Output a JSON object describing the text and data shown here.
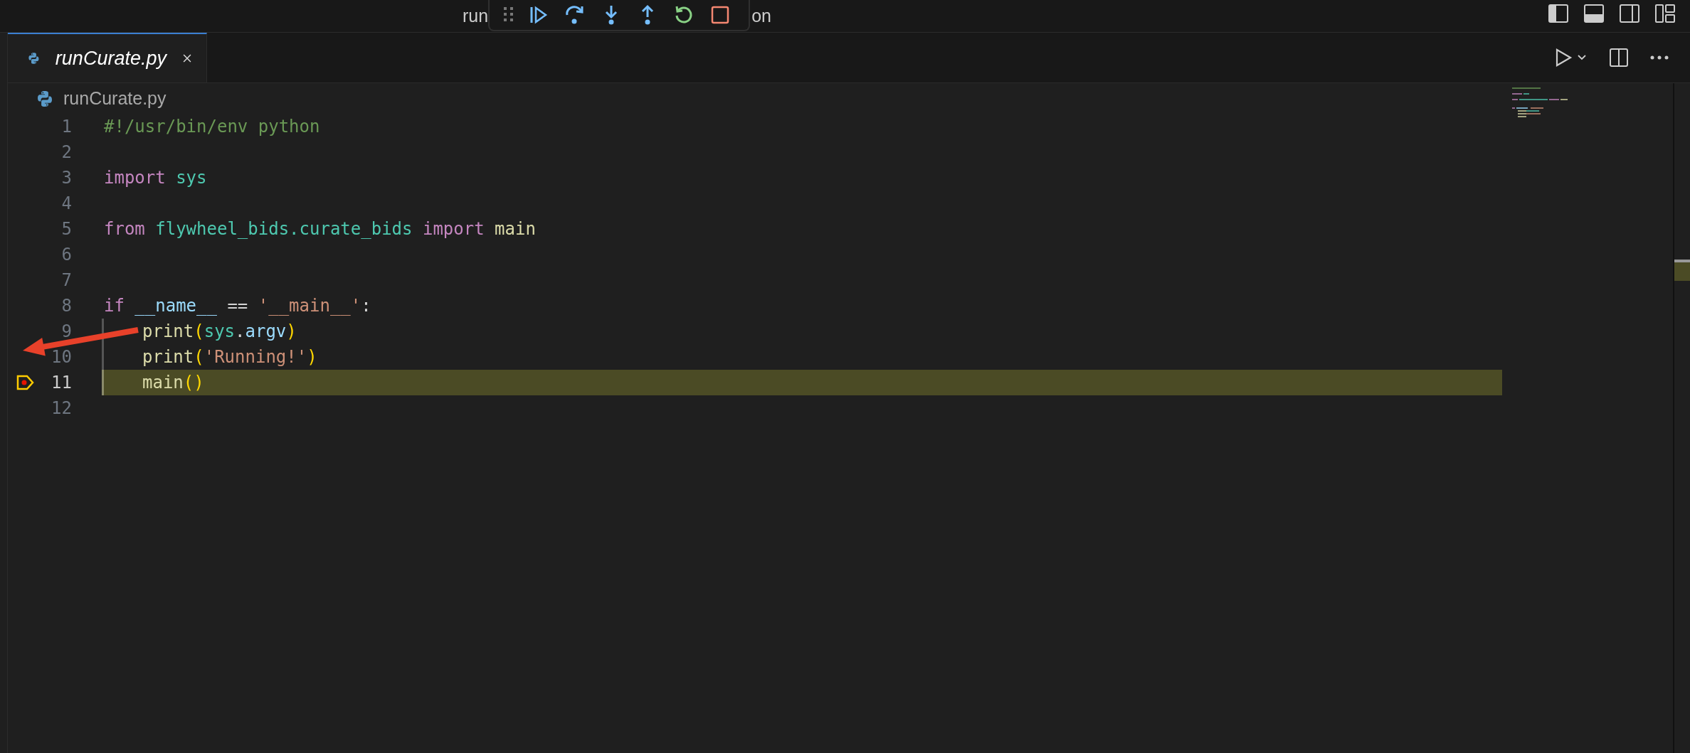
{
  "window": {
    "title_start": "run",
    "title_end": "on"
  },
  "debug_toolbar": [
    {
      "kind": "continue"
    },
    {
      "kind": "step-over"
    },
    {
      "kind": "step-into"
    },
    {
      "kind": "step-out"
    },
    {
      "kind": "restart"
    },
    {
      "kind": "stop"
    }
  ],
  "tabs": [
    {
      "label": "runCurate.py",
      "selected": true
    }
  ],
  "breadcrumb": "runCurate.py",
  "lines": [
    {
      "number": "1",
      "current": false,
      "breakpoint": false,
      "indented": false,
      "tokens": [
        {
          "text": "#!/usr/bin/env python",
          "kind": "comment"
        }
      ]
    },
    {
      "number": "2",
      "current": false,
      "breakpoint": false,
      "indented": false
    },
    {
      "number": "3",
      "current": false,
      "breakpoint": false,
      "indented": false,
      "tokens": [
        {
          "text": "import ",
          "kind": "keyword"
        },
        {
          "text": "sys",
          "kind": "module"
        }
      ]
    },
    {
      "number": "4",
      "current": false,
      "breakpoint": false,
      "indented": false
    },
    {
      "number": "5",
      "current": false,
      "breakpoint": false,
      "indented": false,
      "tokens": [
        {
          "text": "from ",
          "kind": "keyword"
        },
        {
          "text": "flywheel_bids.curate_bids ",
          "kind": "module"
        },
        {
          "text": "import ",
          "kind": "keyword"
        },
        {
          "text": "main",
          "kind": "function"
        }
      ]
    },
    {
      "number": "6",
      "current": false,
      "breakpoint": false,
      "indented": false
    },
    {
      "number": "7",
      "current": false,
      "breakpoint": false,
      "indented": false
    },
    {
      "number": "8",
      "current": false,
      "breakpoint": false,
      "indented": false,
      "tokens": [
        {
          "text": "if ",
          "kind": "keyword"
        },
        {
          "text": "__name__",
          "kind": "variable"
        },
        {
          "text": " == ",
          "kind": "plain"
        },
        {
          "text": "'__main__'",
          "kind": "string"
        },
        {
          "text": ":",
          "kind": "plain"
        }
      ]
    },
    {
      "number": "9",
      "current": false,
      "breakpoint": false,
      "indented": true,
      "tokens": [
        {
          "text": "print",
          "kind": "function"
        },
        {
          "text": "(",
          "kind": "bracket"
        },
        {
          "text": "sys",
          "kind": "module"
        },
        {
          "text": ".",
          "kind": "plain"
        },
        {
          "text": "argv",
          "kind": "variable"
        },
        {
          "text": ")",
          "kind": "bracket"
        }
      ]
    },
    {
      "number": "10",
      "current": false,
      "breakpoint": false,
      "indented": true,
      "tokens": [
        {
          "text": "print",
          "kind": "function"
        },
        {
          "text": "(",
          "kind": "bracket"
        },
        {
          "text": "'Running!'",
          "kind": "string"
        },
        {
          "text": ")",
          "kind": "bracket"
        }
      ]
    },
    {
      "number": "11",
      "current": true,
      "breakpoint": true,
      "indented": true,
      "tokens": [
        {
          "text": "main",
          "kind": "function"
        },
        {
          "text": "()",
          "kind": "bracket"
        }
      ]
    },
    {
      "number": "12",
      "current": false,
      "breakpoint": false,
      "indented": false
    }
  ]
}
